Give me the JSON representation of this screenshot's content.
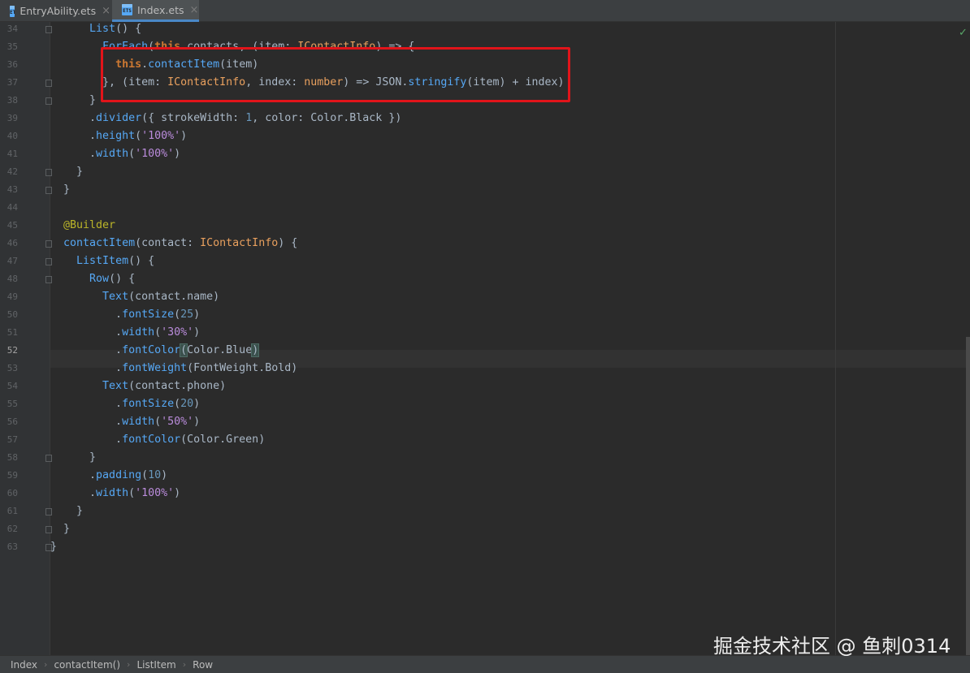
{
  "tabs": [
    {
      "label": "EntryAbility.ets",
      "active": false,
      "icon": "ets-file-icon"
    },
    {
      "label": "Index.ets",
      "active": true,
      "icon": "ets-file-icon"
    }
  ],
  "tab_icon_text": "ETS",
  "close_glyph": "×",
  "line_numbers": [
    "34",
    "35",
    "36",
    "37",
    "38",
    "39",
    "40",
    "41",
    "42",
    "43",
    "44",
    "45",
    "46",
    "47",
    "48",
    "49",
    "50",
    "51",
    "52",
    "53",
    "54",
    "55",
    "56",
    "57",
    "58",
    "59",
    "60",
    "61",
    "62",
    "63"
  ],
  "current_line": "52",
  "code_lines": [
    [
      [
        "t-default",
        "      "
      ],
      [
        "t-method",
        "List"
      ],
      [
        "t-default",
        "() {"
      ]
    ],
    [
      [
        "t-default",
        "        "
      ],
      [
        "t-method",
        "ForEach"
      ],
      [
        "t-default",
        "("
      ],
      [
        "t-kw-bold",
        "this"
      ],
      [
        "t-default",
        ".contacts, (item: "
      ],
      [
        "t-type",
        "IContactInfo"
      ],
      [
        "t-default",
        ") => {"
      ]
    ],
    [
      [
        "t-default",
        "          "
      ],
      [
        "t-kw-bold",
        "this"
      ],
      [
        "t-default",
        "."
      ],
      [
        "t-method",
        "contactItem"
      ],
      [
        "t-default",
        "(item)"
      ]
    ],
    [
      [
        "t-default",
        "        }, (item: "
      ],
      [
        "t-type",
        "IContactInfo"
      ],
      [
        "t-default",
        ", index: "
      ],
      [
        "t-type",
        "number"
      ],
      [
        "t-default",
        ") => JSON."
      ],
      [
        "t-method",
        "stringify"
      ],
      [
        "t-default",
        "(item) + index)"
      ]
    ],
    [
      [
        "t-default",
        "      }"
      ]
    ],
    [
      [
        "t-default",
        "      ."
      ],
      [
        "t-method",
        "divider"
      ],
      [
        "t-default",
        "({ strokeWidth: "
      ],
      [
        "t-number",
        "1"
      ],
      [
        "t-default",
        ", color: Color.Black })"
      ]
    ],
    [
      [
        "t-default",
        "      ."
      ],
      [
        "t-method",
        "height"
      ],
      [
        "t-default",
        "("
      ],
      [
        "t-string",
        "'100%'"
      ],
      [
        "t-default",
        ")"
      ]
    ],
    [
      [
        "t-default",
        "      ."
      ],
      [
        "t-method",
        "width"
      ],
      [
        "t-default",
        "("
      ],
      [
        "t-string",
        "'100%'"
      ],
      [
        "t-default",
        ")"
      ]
    ],
    [
      [
        "t-default",
        "    }"
      ]
    ],
    [
      [
        "t-default",
        "  }"
      ]
    ],
    [
      [
        "t-default",
        ""
      ]
    ],
    [
      [
        "t-default",
        "  "
      ],
      [
        "t-annotation",
        "@Builder"
      ]
    ],
    [
      [
        "t-default",
        "  "
      ],
      [
        "t-method",
        "contactItem"
      ],
      [
        "t-default",
        "(contact: "
      ],
      [
        "t-type",
        "IContactInfo"
      ],
      [
        "t-default",
        ") {"
      ]
    ],
    [
      [
        "t-default",
        "    "
      ],
      [
        "t-method",
        "ListItem"
      ],
      [
        "t-default",
        "() {"
      ]
    ],
    [
      [
        "t-default",
        "      "
      ],
      [
        "t-method",
        "Row"
      ],
      [
        "t-default",
        "() {"
      ]
    ],
    [
      [
        "t-default",
        "        "
      ],
      [
        "t-method",
        "Text"
      ],
      [
        "t-default",
        "(contact.name)"
      ]
    ],
    [
      [
        "t-default",
        "          ."
      ],
      [
        "t-method",
        "fontSize"
      ],
      [
        "t-default",
        "("
      ],
      [
        "t-number",
        "25"
      ],
      [
        "t-default",
        ")"
      ]
    ],
    [
      [
        "t-default",
        "          ."
      ],
      [
        "t-method",
        "width"
      ],
      [
        "t-default",
        "("
      ],
      [
        "t-string",
        "'30%'"
      ],
      [
        "t-default",
        ")"
      ]
    ],
    [
      [
        "t-default",
        "          ."
      ],
      [
        "t-method",
        "fontColor"
      ],
      [
        "t-bracket-match",
        "("
      ],
      [
        "t-default",
        "Color.Blue"
      ],
      [
        "t-bracket-match",
        ")"
      ]
    ],
    [
      [
        "t-default",
        "          ."
      ],
      [
        "t-method",
        "fontWeight"
      ],
      [
        "t-default",
        "(FontWeight.Bold)"
      ]
    ],
    [
      [
        "t-default",
        "        "
      ],
      [
        "t-method",
        "Text"
      ],
      [
        "t-default",
        "(contact.phone)"
      ]
    ],
    [
      [
        "t-default",
        "          ."
      ],
      [
        "t-method",
        "fontSize"
      ],
      [
        "t-default",
        "("
      ],
      [
        "t-number",
        "20"
      ],
      [
        "t-default",
        ")"
      ]
    ],
    [
      [
        "t-default",
        "          ."
      ],
      [
        "t-method",
        "width"
      ],
      [
        "t-default",
        "("
      ],
      [
        "t-string",
        "'50%'"
      ],
      [
        "t-default",
        ")"
      ]
    ],
    [
      [
        "t-default",
        "          ."
      ],
      [
        "t-method",
        "fontColor"
      ],
      [
        "t-default",
        "(Color.Green)"
      ]
    ],
    [
      [
        "t-default",
        "      }"
      ]
    ],
    [
      [
        "t-default",
        "      ."
      ],
      [
        "t-method",
        "padding"
      ],
      [
        "t-default",
        "("
      ],
      [
        "t-number",
        "10"
      ],
      [
        "t-default",
        ")"
      ]
    ],
    [
      [
        "t-default",
        "      ."
      ],
      [
        "t-method",
        "width"
      ],
      [
        "t-default",
        "("
      ],
      [
        "t-string",
        "'100%'"
      ],
      [
        "t-default",
        ")"
      ]
    ],
    [
      [
        "t-default",
        "    }"
      ]
    ],
    [
      [
        "t-default",
        "  }"
      ]
    ],
    [
      [
        "t-default",
        "}"
      ]
    ]
  ],
  "fold_marker_lines": [
    "34",
    "37",
    "38",
    "42",
    "43",
    "46",
    "47",
    "48",
    "58",
    "61",
    "62",
    "63"
  ],
  "breadcrumb": [
    "Index",
    "contactItem()",
    "ListItem",
    "Row"
  ],
  "breadcrumb_sep": "›",
  "status_check": "✓",
  "watermark": "掘金技术社区 @ 鱼刺0314",
  "colors": {
    "editor_bg": "#2b2b2b",
    "highlight_border": "#e1141a",
    "keyword": "#cc7832",
    "method": "#56a8f5",
    "string": "#bb8cdc",
    "type": "#e9a05e",
    "number": "#6897bb"
  }
}
